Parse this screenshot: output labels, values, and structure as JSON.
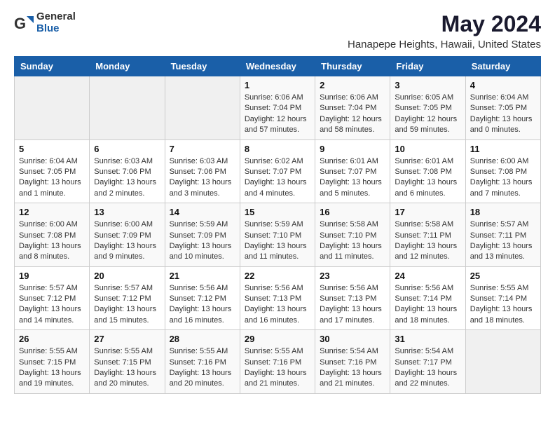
{
  "logo": {
    "general": "General",
    "blue": "Blue"
  },
  "title": "May 2024",
  "subtitle": "Hanapepe Heights, Hawaii, United States",
  "days_of_week": [
    "Sunday",
    "Monday",
    "Tuesday",
    "Wednesday",
    "Thursday",
    "Friday",
    "Saturday"
  ],
  "weeks": [
    [
      {
        "day": "",
        "info": ""
      },
      {
        "day": "",
        "info": ""
      },
      {
        "day": "",
        "info": ""
      },
      {
        "day": "1",
        "info": "Sunrise: 6:06 AM\nSunset: 7:04 PM\nDaylight: 12 hours and 57 minutes."
      },
      {
        "day": "2",
        "info": "Sunrise: 6:06 AM\nSunset: 7:04 PM\nDaylight: 12 hours and 58 minutes."
      },
      {
        "day": "3",
        "info": "Sunrise: 6:05 AM\nSunset: 7:05 PM\nDaylight: 12 hours and 59 minutes."
      },
      {
        "day": "4",
        "info": "Sunrise: 6:04 AM\nSunset: 7:05 PM\nDaylight: 13 hours and 0 minutes."
      }
    ],
    [
      {
        "day": "5",
        "info": "Sunrise: 6:04 AM\nSunset: 7:05 PM\nDaylight: 13 hours and 1 minute."
      },
      {
        "day": "6",
        "info": "Sunrise: 6:03 AM\nSunset: 7:06 PM\nDaylight: 13 hours and 2 minutes."
      },
      {
        "day": "7",
        "info": "Sunrise: 6:03 AM\nSunset: 7:06 PM\nDaylight: 13 hours and 3 minutes."
      },
      {
        "day": "8",
        "info": "Sunrise: 6:02 AM\nSunset: 7:07 PM\nDaylight: 13 hours and 4 minutes."
      },
      {
        "day": "9",
        "info": "Sunrise: 6:01 AM\nSunset: 7:07 PM\nDaylight: 13 hours and 5 minutes."
      },
      {
        "day": "10",
        "info": "Sunrise: 6:01 AM\nSunset: 7:08 PM\nDaylight: 13 hours and 6 minutes."
      },
      {
        "day": "11",
        "info": "Sunrise: 6:00 AM\nSunset: 7:08 PM\nDaylight: 13 hours and 7 minutes."
      }
    ],
    [
      {
        "day": "12",
        "info": "Sunrise: 6:00 AM\nSunset: 7:08 PM\nDaylight: 13 hours and 8 minutes."
      },
      {
        "day": "13",
        "info": "Sunrise: 6:00 AM\nSunset: 7:09 PM\nDaylight: 13 hours and 9 minutes."
      },
      {
        "day": "14",
        "info": "Sunrise: 5:59 AM\nSunset: 7:09 PM\nDaylight: 13 hours and 10 minutes."
      },
      {
        "day": "15",
        "info": "Sunrise: 5:59 AM\nSunset: 7:10 PM\nDaylight: 13 hours and 11 minutes."
      },
      {
        "day": "16",
        "info": "Sunrise: 5:58 AM\nSunset: 7:10 PM\nDaylight: 13 hours and 11 minutes."
      },
      {
        "day": "17",
        "info": "Sunrise: 5:58 AM\nSunset: 7:11 PM\nDaylight: 13 hours and 12 minutes."
      },
      {
        "day": "18",
        "info": "Sunrise: 5:57 AM\nSunset: 7:11 PM\nDaylight: 13 hours and 13 minutes."
      }
    ],
    [
      {
        "day": "19",
        "info": "Sunrise: 5:57 AM\nSunset: 7:12 PM\nDaylight: 13 hours and 14 minutes."
      },
      {
        "day": "20",
        "info": "Sunrise: 5:57 AM\nSunset: 7:12 PM\nDaylight: 13 hours and 15 minutes."
      },
      {
        "day": "21",
        "info": "Sunrise: 5:56 AM\nSunset: 7:12 PM\nDaylight: 13 hours and 16 minutes."
      },
      {
        "day": "22",
        "info": "Sunrise: 5:56 AM\nSunset: 7:13 PM\nDaylight: 13 hours and 16 minutes."
      },
      {
        "day": "23",
        "info": "Sunrise: 5:56 AM\nSunset: 7:13 PM\nDaylight: 13 hours and 17 minutes."
      },
      {
        "day": "24",
        "info": "Sunrise: 5:56 AM\nSunset: 7:14 PM\nDaylight: 13 hours and 18 minutes."
      },
      {
        "day": "25",
        "info": "Sunrise: 5:55 AM\nSunset: 7:14 PM\nDaylight: 13 hours and 18 minutes."
      }
    ],
    [
      {
        "day": "26",
        "info": "Sunrise: 5:55 AM\nSunset: 7:15 PM\nDaylight: 13 hours and 19 minutes."
      },
      {
        "day": "27",
        "info": "Sunrise: 5:55 AM\nSunset: 7:15 PM\nDaylight: 13 hours and 20 minutes."
      },
      {
        "day": "28",
        "info": "Sunrise: 5:55 AM\nSunset: 7:16 PM\nDaylight: 13 hours and 20 minutes."
      },
      {
        "day": "29",
        "info": "Sunrise: 5:55 AM\nSunset: 7:16 PM\nDaylight: 13 hours and 21 minutes."
      },
      {
        "day": "30",
        "info": "Sunrise: 5:54 AM\nSunset: 7:16 PM\nDaylight: 13 hours and 21 minutes."
      },
      {
        "day": "31",
        "info": "Sunrise: 5:54 AM\nSunset: 7:17 PM\nDaylight: 13 hours and 22 minutes."
      },
      {
        "day": "",
        "info": ""
      }
    ]
  ]
}
